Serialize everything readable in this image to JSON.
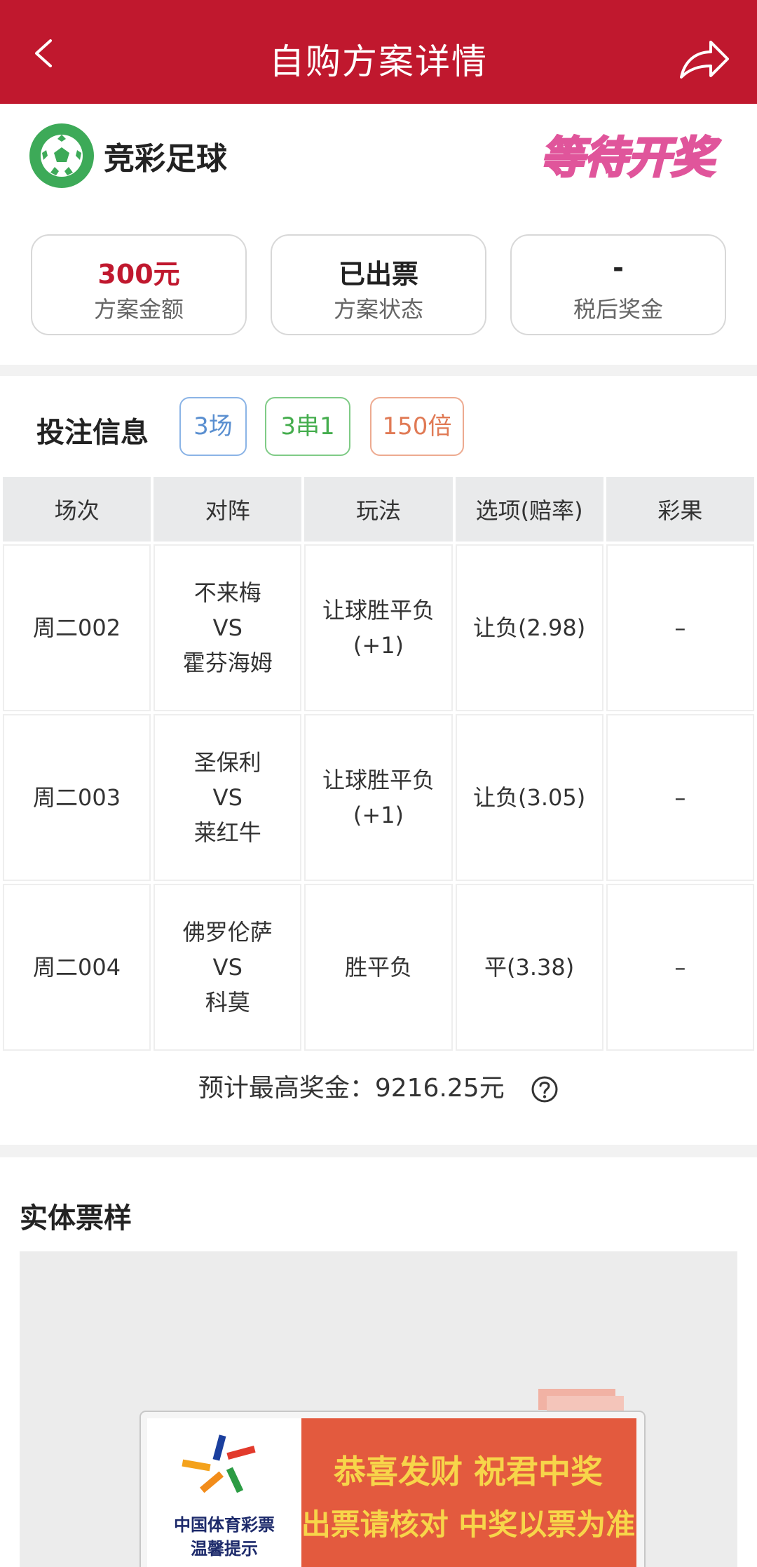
{
  "header": {
    "title": "自购方案详情",
    "back_icon": "chevron-left-icon",
    "share_icon": "share-icon"
  },
  "lottery": {
    "name": "竞彩足球",
    "status": "等待开奖"
  },
  "summary": [
    {
      "value": "300元",
      "label": "方案金额"
    },
    {
      "value": "已出票",
      "label": "方案状态"
    },
    {
      "value": "-",
      "label": "税后奖金"
    }
  ],
  "bet_info": {
    "label": "投注信息",
    "tags": [
      "3场",
      "3串1",
      "150倍"
    ]
  },
  "table": {
    "headers": [
      "场次",
      "对阵",
      "玩法",
      "选项(赔率)",
      "彩果"
    ],
    "rows": [
      {
        "session": "周二002",
        "home": "不来梅",
        "vs": "VS",
        "away": "霍芬海姆",
        "play": "让球胜平负",
        "handicap": "(+1)",
        "option": "让负(2.98)",
        "result": "–"
      },
      {
        "session": "周二003",
        "home": "圣保利",
        "vs": "VS",
        "away": "莱红牛",
        "play": "让球胜平负",
        "handicap": "(+1)",
        "option": "让负(3.05)",
        "result": "–"
      },
      {
        "session": "周二004",
        "home": "佛罗伦萨",
        "vs": "VS",
        "away": "科莫",
        "play": "胜平负",
        "handicap": "",
        "option": "平(3.38)",
        "result": "–"
      }
    ]
  },
  "max_prize": "预计最高奖金：9216.25元",
  "ticket": {
    "title": "实体票样",
    "org_name": "中国体育彩票",
    "org_sub": "温馨提示",
    "line1": "恭喜发财 祝君中奖",
    "line2": "出票请核对 中奖以票为准"
  },
  "colors": {
    "brand_red": "#c0182e",
    "green": "#3daa58"
  }
}
